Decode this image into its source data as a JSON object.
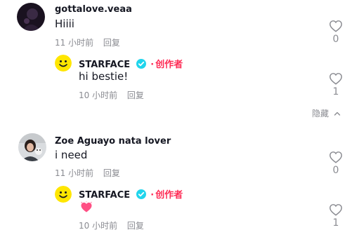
{
  "comments": [
    {
      "username": "gottalove.veaa",
      "text": "Hiiii",
      "time": "11 小时前",
      "reply_label": "回复",
      "likes": "0",
      "avatar_icon": "dark-portrait-avatar"
    },
    {
      "username": "Zoe Aguayo nata lover",
      "text": "i need",
      "time": "11 小时前",
      "reply_label": "回复",
      "likes": "0",
      "avatar_icon": "photo-portrait-avatar"
    }
  ],
  "replies": [
    {
      "username": "STARFACE",
      "verified": true,
      "dot": "·",
      "role": "创作者",
      "text": "hi bestie!",
      "time": "10 小时前",
      "reply_label": "回复",
      "likes": "1",
      "avatar_icon": "yellow-smiley-avatar"
    },
    {
      "username": "STARFACE",
      "verified": true,
      "dot": "·",
      "role": "创作者",
      "text": "",
      "emoji_icon": "heart-emoji-icon",
      "time": "10 小时前",
      "reply_label": "回复",
      "likes": "1",
      "avatar_icon": "yellow-smiley-avatar"
    }
  ],
  "hide_label": "隐藏",
  "colors": {
    "accent": "#fe2c55",
    "verified": "#20d5ec",
    "smiley": "#ffe600",
    "muted": "#8a8b91"
  }
}
